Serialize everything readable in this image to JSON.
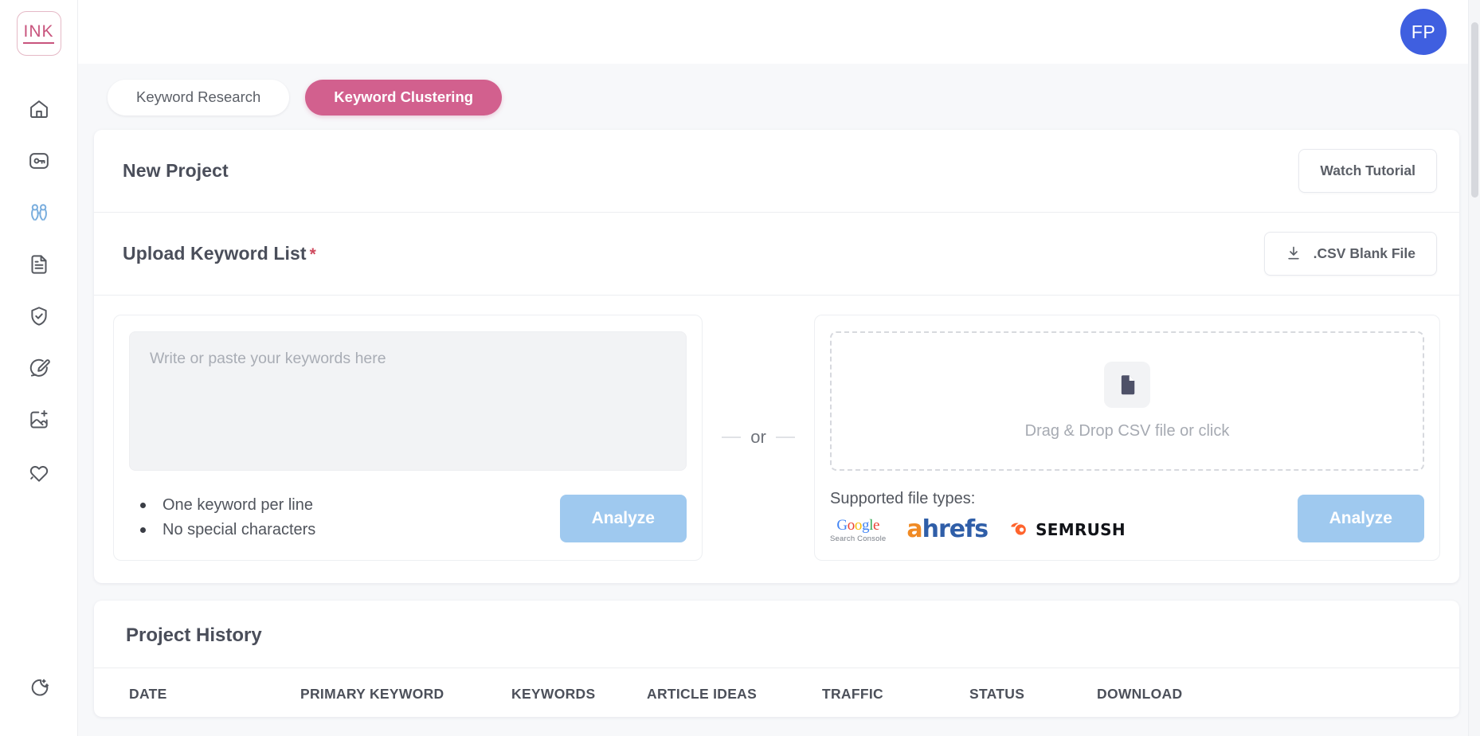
{
  "brand": {
    "logo_text": "INK"
  },
  "account": {
    "avatar_initials": "FP"
  },
  "sidebar": {
    "items": [
      {
        "name": "home",
        "icon": "home-icon"
      },
      {
        "name": "keywords",
        "icon": "key-box-icon"
      },
      {
        "name": "clustering",
        "icon": "cluster-icon",
        "active": true
      },
      {
        "name": "documents",
        "icon": "document-icon"
      },
      {
        "name": "optimizer",
        "icon": "shield-check-icon"
      },
      {
        "name": "editor",
        "icon": "edit-circle-icon"
      },
      {
        "name": "images",
        "icon": "image-plus-icon"
      },
      {
        "name": "favorites",
        "icon": "heart-icon"
      }
    ],
    "bottom_items": [
      {
        "name": "dark-mode",
        "icon": "moon-stars-icon"
      }
    ]
  },
  "tabs": [
    {
      "label": "Keyword Research",
      "active": false
    },
    {
      "label": "Keyword Clustering",
      "active": true
    }
  ],
  "new_project": {
    "title": "New Project",
    "watch_tutorial_label": "Watch Tutorial"
  },
  "upload": {
    "title": "Upload Keyword List",
    "required_marker": "*",
    "csv_blank_label": ".CSV Blank File",
    "csv_blank_icon": "download-icon",
    "textarea_placeholder": "Write or paste your keywords here",
    "textarea_value": "",
    "hints": [
      "One keyword per line",
      "No special characters"
    ],
    "analyze_left_label": "Analyze",
    "or_label": "or",
    "dropzone_text": "Drag & Drop CSV file or click",
    "dropzone_icon": "file-icon",
    "supported_label": "Supported file types:",
    "supported_logos": [
      {
        "name": "google-search-console",
        "word": "Google",
        "sub": "Search Console"
      },
      {
        "name": "ahrefs",
        "word": "ahrefs"
      },
      {
        "name": "semrush",
        "word": "SEMRUSH"
      }
    ],
    "analyze_right_label": "Analyze"
  },
  "history": {
    "title": "Project History",
    "columns": [
      "DATE",
      "PRIMARY KEYWORD",
      "KEYWORDS",
      "ARTICLE IDEAS",
      "TRAFFIC",
      "STATUS",
      "DOWNLOAD"
    ],
    "rows": []
  },
  "colors": {
    "accent_pink": "#d2608e",
    "accent_blue": "#9fc9ef",
    "avatar_blue": "#3f5fe0",
    "required_red": "#cf4a5e",
    "brand_pink": "#c8547d"
  }
}
